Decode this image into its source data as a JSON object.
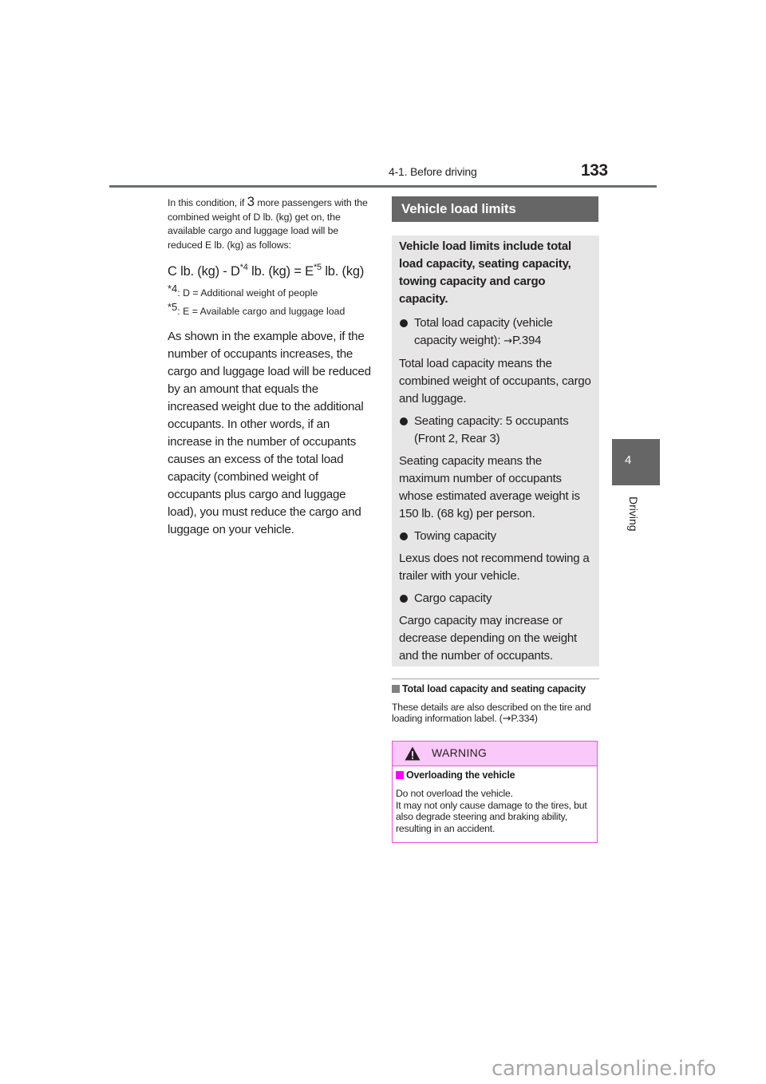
{
  "header": {
    "section": "4-1. Before driving",
    "page_number": "133"
  },
  "side_tab": {
    "chapter_number": "4",
    "chapter_label": "Driving"
  },
  "left_column": {
    "intro_part1": "In this condition, if ",
    "intro_number": "3",
    "intro_part2": " more passengers with the combined weight of D lb. (kg) get on, the available cargo and luggage load will be reduced E lb. (kg) as follows:",
    "formula": {
      "part1": "C lb. (kg) - D",
      "sup1": "*4",
      "part2": " lb. (kg) = E",
      "sup2": "*5",
      "part3": " lb. (kg)"
    },
    "footnotes": [
      {
        "mark": "*4",
        "text": ": D = Additional weight of people"
      },
      {
        "mark": "*5",
        "text": ": E = Available cargo and luggage load"
      }
    ],
    "body": "As shown in the example above, if the number of occupants increases, the cargo and luggage load will be reduced by an amount that equals the increased weight due to the additional occupants. In other words, if an increase in the number of occupants causes an excess of the total load capacity (combined weight of occupants plus cargo and luggage load), you must reduce the cargo and luggage on your vehicle."
  },
  "vehicle_load_limits": {
    "heading": "Vehicle load limits",
    "intro": "Vehicle load limits include total load capacity, seating capacity, towing capacity and cargo capacity.",
    "items": [
      {
        "bullet": "Total load capacity (vehicle capacity weight): ",
        "arrow": "→",
        "ref": "P.394",
        "description": "Total load capacity means the combined weight of occupants, cargo and luggage."
      },
      {
        "bullet": "Seating capacity: 5 occupants (Front 2, Rear 3)",
        "description": "Seating capacity means the maximum number of occupants whose estimated average weight is 150 lb. (68 kg) per person."
      },
      {
        "bullet": "Towing capacity",
        "description": "Lexus does not recommend towing a trailer with your vehicle."
      },
      {
        "bullet": "Cargo capacity",
        "description": "Cargo capacity may increase or decrease depending on the weight and the number of occupants."
      }
    ]
  },
  "total_load_section": {
    "heading": "Total load capacity and seating capacity",
    "body_part1": "These details are also described on the tire and loading information label. (",
    "arrow": "→",
    "ref": "P.334",
    "body_part2": ")"
  },
  "warning": {
    "title": "WARNING",
    "subheading": "Overloading the vehicle",
    "lines": [
      "Do not overload the vehicle.",
      "It may not only cause damage to the tires, but also degrade steering and braking ability, resulting in an accident."
    ],
    "accent_color": "#ec4fe8",
    "header_bg": "#fbc8fa"
  },
  "watermark": "carmanualsonline.info"
}
